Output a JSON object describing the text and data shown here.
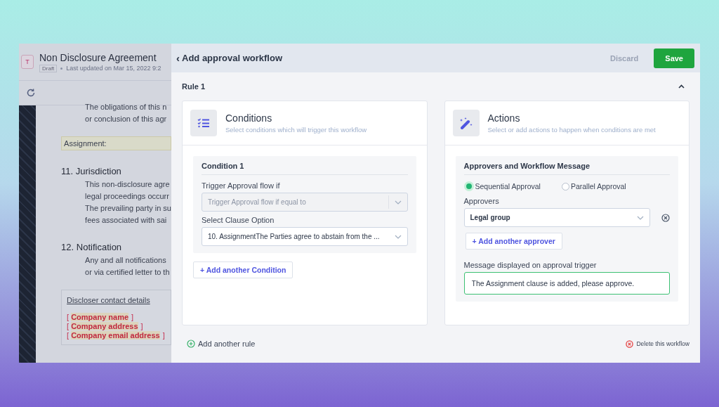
{
  "document": {
    "logo_letter": "T",
    "title": "Non Disclosure Agreement",
    "status": "Draft",
    "updated": "Last updated on Mar 15, 2022 9:2",
    "blocks": [
      {
        "kind": "paragraph",
        "lines": [
          "The obligations of this n",
          "or conclusion of this agr"
        ]
      },
      {
        "kind": "field",
        "text": "Assignment:"
      },
      {
        "kind": "heading",
        "text": "11. Jurisdiction"
      },
      {
        "kind": "paragraph",
        "lines": [
          "This non-disclosure agre",
          "legal proceedings occurr",
          "The prevailing party in su",
          "fees associated with sai"
        ]
      },
      {
        "kind": "heading",
        "text": "12. Notification"
      },
      {
        "kind": "paragraph",
        "lines": [
          "Any and all notifications",
          "or via certified letter to th"
        ]
      },
      {
        "kind": "contact",
        "title": "Discloser contact details",
        "placeholders": [
          "Company name",
          "Company address",
          "Company email address"
        ],
        "open": "[",
        "close": "]"
      }
    ]
  },
  "drawer": {
    "back": "‹",
    "title": "Add approval workflow",
    "discard": "Discard",
    "save": "Save",
    "rule": {
      "title": "Rule 1",
      "expanded": true
    },
    "conditions": {
      "title": "Conditions",
      "subtitle": "Select conditions which will trigger this workflow",
      "groups": [
        {
          "title": "Condition 1",
          "fields": [
            {
              "label": "Trigger Approval flow if",
              "value": "Trigger Approval flow if equal to",
              "disabled": true
            },
            {
              "label": "Select Clause Option",
              "value": "10. AssignmentThe Parties agree to abstain from the ...",
              "disabled": false
            }
          ]
        }
      ],
      "add_button": "+ Add another Condition"
    },
    "actions": {
      "title": "Actions",
      "subtitle": "Select or add actions to happen when conditions are met",
      "section_title": "Approvers and Workflow Message",
      "approval_types": [
        {
          "label": "Sequential Approval",
          "selected": true
        },
        {
          "label": "Parallel Approval",
          "selected": false
        }
      ],
      "approvers_label": "Approvers",
      "approvers": [
        {
          "value": "Legal group"
        }
      ],
      "add_approver": "+ Add another approver",
      "message_label": "Message displayed on approval trigger",
      "message": "The Assignment clause is added, please approve."
    },
    "add_rule": "Add another rule",
    "delete": "Delete this workflow"
  }
}
